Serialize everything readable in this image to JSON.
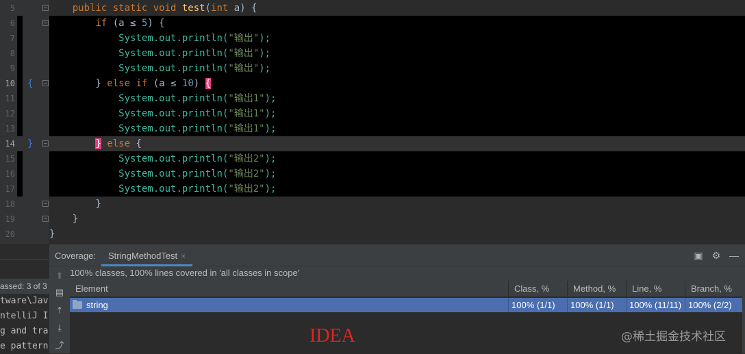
{
  "editor": {
    "lines": [
      {
        "n": "5",
        "tokens": [
          {
            "t": "    "
          },
          {
            "t": "public static void ",
            "c": "kw"
          },
          {
            "t": "test",
            "c": "fn"
          },
          {
            "t": "("
          },
          {
            "t": "int ",
            "c": "kw"
          },
          {
            "t": "a) {"
          }
        ],
        "dark": false
      },
      {
        "n": "6",
        "tokens": [
          {
            "t": "        "
          },
          {
            "t": "if ",
            "c": "kw"
          },
          {
            "t": "(a ≤ "
          },
          {
            "t": "5",
            "c": "num-lit"
          },
          {
            "t": ") {"
          }
        ],
        "dark": true
      },
      {
        "n": "7",
        "tokens": [
          {
            "t": "            "
          },
          {
            "t": "System.out.println(",
            "c": "sout"
          },
          {
            "t": "\"输出\"",
            "c": "str"
          },
          {
            "t": ");",
            "c": "sout"
          }
        ],
        "dark": true
      },
      {
        "n": "8",
        "tokens": [
          {
            "t": "            "
          },
          {
            "t": "System.out.println(",
            "c": "sout"
          },
          {
            "t": "\"输出\"",
            "c": "str"
          },
          {
            "t": ");",
            "c": "sout"
          }
        ],
        "dark": true
      },
      {
        "n": "9",
        "tokens": [
          {
            "t": "            "
          },
          {
            "t": "System.out.println(",
            "c": "sout"
          },
          {
            "t": "\"输出\"",
            "c": "str"
          },
          {
            "t": ");",
            "c": "sout"
          }
        ],
        "dark": true
      },
      {
        "n": "10",
        "tokens": [
          {
            "t": "        } "
          },
          {
            "t": "else if ",
            "c": "kw"
          },
          {
            "t": "(a ≤ "
          },
          {
            "t": "10",
            "c": "num-lit"
          },
          {
            "t": ") "
          },
          {
            "t": "{",
            "c": "hl-brace"
          }
        ],
        "dark": true
      },
      {
        "n": "11",
        "tokens": [
          {
            "t": "            "
          },
          {
            "t": "System.out.println(",
            "c": "sout"
          },
          {
            "t": "\"输出1\"",
            "c": "str"
          },
          {
            "t": ");",
            "c": "sout"
          }
        ],
        "dark": true
      },
      {
        "n": "12",
        "tokens": [
          {
            "t": "            "
          },
          {
            "t": "System.out.println(",
            "c": "sout"
          },
          {
            "t": "\"输出1\"",
            "c": "str"
          },
          {
            "t": ");",
            "c": "sout"
          }
        ],
        "dark": true
      },
      {
        "n": "13",
        "tokens": [
          {
            "t": "            "
          },
          {
            "t": "System.out.println(",
            "c": "sout"
          },
          {
            "t": "\"输出1\"",
            "c": "str"
          },
          {
            "t": ");",
            "c": "sout"
          }
        ],
        "dark": true
      },
      {
        "n": "14",
        "tokens": [
          {
            "t": "        "
          },
          {
            "t": "}",
            "c": "hl-brace"
          },
          {
            "t": " else ",
            "c": "kw"
          },
          {
            "t": "{"
          }
        ],
        "dark": false,
        "current": true
      },
      {
        "n": "15",
        "tokens": [
          {
            "t": "            "
          },
          {
            "t": "System.out.println(",
            "c": "sout"
          },
          {
            "t": "\"输出2\"",
            "c": "str"
          },
          {
            "t": ");",
            "c": "sout"
          }
        ],
        "dark": true
      },
      {
        "n": "16",
        "tokens": [
          {
            "t": "            "
          },
          {
            "t": "System.out.println(",
            "c": "sout"
          },
          {
            "t": "\"输出2\"",
            "c": "str"
          },
          {
            "t": ");",
            "c": "sout"
          }
        ],
        "dark": true
      },
      {
        "n": "17",
        "tokens": [
          {
            "t": "            "
          },
          {
            "t": "System.out.println(",
            "c": "sout"
          },
          {
            "t": "\"输出2\"",
            "c": "str"
          },
          {
            "t": ");",
            "c": "sout"
          }
        ],
        "dark": true
      },
      {
        "n": "18",
        "tokens": [
          {
            "t": "        }"
          }
        ],
        "dark": false
      },
      {
        "n": "19",
        "tokens": [
          {
            "t": "    }"
          }
        ],
        "dark": false
      },
      {
        "n": "20",
        "tokens": [
          {
            "t": "}"
          }
        ],
        "dark": false
      }
    ],
    "gutter_braces": {
      "open": "{",
      "close": "}"
    }
  },
  "console": {
    "passed": "assed: 3 of 3",
    "lines": [
      "tware\\Jav",
      "ntelliJ I",
      "g and tra",
      "e pattern"
    ]
  },
  "coverage": {
    "label": "Coverage:",
    "tab": "StringMethodTest",
    "tab_close": "×",
    "summary": "100% classes, 100% lines covered in 'all classes in scope'",
    "columns": [
      "Element",
      "Class, %",
      "Method, %",
      "Line, %",
      "Branch, %"
    ],
    "rows": [
      {
        "element": "string",
        "class": "100% (1/1)",
        "method": "100% (1/1)",
        "line": "100% (11/11)",
        "branch": "100% (2/2)"
      }
    ]
  },
  "overlay": {
    "idea": "IDEA",
    "watermark": "@稀土掘金技术社区"
  },
  "icons": {
    "panel_right": [
      "restore-layout-icon",
      "gear-icon",
      "minimize-icon"
    ],
    "side_tools": [
      "up-arrow-icon",
      "flatten-packages-icon",
      "autoscroll-to-source-icon",
      "autoscroll-from-source-icon",
      "export-icon"
    ]
  }
}
